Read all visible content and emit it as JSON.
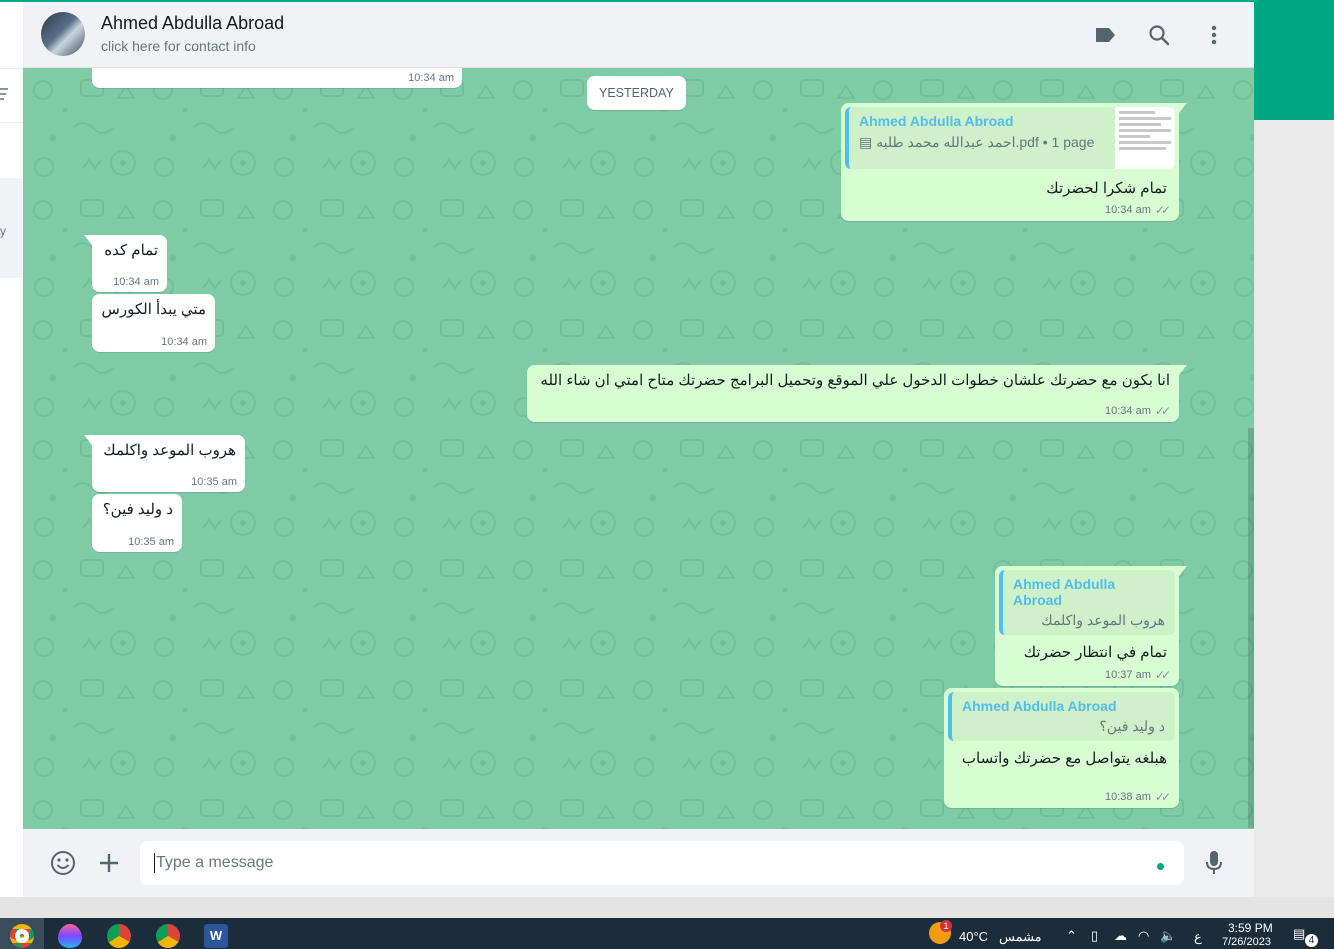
{
  "app": {
    "accent": "#00a884",
    "chat_bg": "#7fcba6",
    "outgoing_bg": "#d9fdd3",
    "incoming_bg": "#ffffff",
    "quote_color": "#53bdeb"
  },
  "sidebar": {
    "partial_char": "y"
  },
  "header": {
    "contact_name": "Ahmed Abdulla Abroad",
    "contact_sub": "click here for contact info",
    "icons": [
      "label-icon",
      "search-icon",
      "menu-icon"
    ]
  },
  "chat": {
    "date_divider": "YESTERDAY",
    "messages": [
      {
        "dir": "in",
        "time": "10:34 am",
        "text": ""
      },
      {
        "dir": "out",
        "doc": {
          "sender": "Ahmed Abdulla Abroad",
          "file": "احمد عبدالله محمد طلبه.pdf • 1 page"
        },
        "text": "تمام شكرا لحضرتك",
        "time": "10:34 am"
      },
      {
        "dir": "in",
        "text": "تمام كده",
        "time": "10:34 am"
      },
      {
        "dir": "in",
        "text": "متي يبدأ الكورس",
        "time": "10:34 am"
      },
      {
        "dir": "out",
        "text": "انا بكون مع حضرتك علشان خطوات الدخول علي الموقع وتحميل البرامج حضرتك متاح امتي ان شاء الله",
        "time": "10:34 am"
      },
      {
        "dir": "in",
        "text": "هروب الموعد واكلمك",
        "time": "10:35 am"
      },
      {
        "dir": "in",
        "text": "د وليد فين؟",
        "time": "10:35 am"
      },
      {
        "dir": "out",
        "quote": {
          "name": "Ahmed Abdulla Abroad",
          "text": "هروب الموعد واكلمك"
        },
        "text": "تمام في انتظار حضرتك",
        "time": "10:37 am"
      },
      {
        "dir": "out",
        "quote": {
          "name": "Ahmed Abdulla Abroad",
          "text": "د وليد فين؟"
        },
        "text": "هبلغه يتواصل مع حضرتك واتساب",
        "time": "10:38 am"
      }
    ]
  },
  "composer": {
    "placeholder": "Type a message",
    "icons": [
      "emoji-icon",
      "attach-plus-icon",
      "microphone-icon"
    ]
  },
  "taskbar": {
    "apps": [
      "chrome-icon",
      "paint-drop-icon",
      "chrome-profile-icon",
      "chrome-profile-icon",
      "word-icon"
    ],
    "weather_temp": "40°C",
    "weather_text": "مشمس",
    "weather_badge": "1",
    "lang": "ع",
    "time": "3:59 PM",
    "date": "7/26/2023",
    "notifications": "4"
  }
}
